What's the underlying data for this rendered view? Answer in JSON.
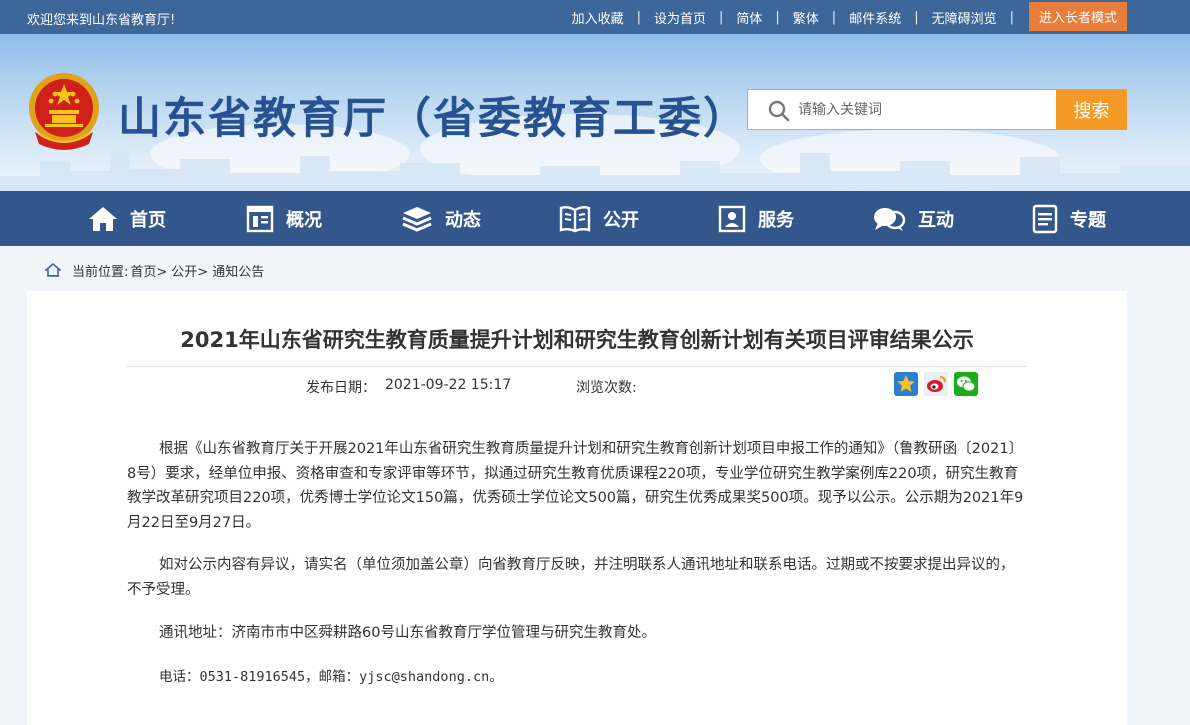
{
  "topbar": {
    "welcome": "欢迎您来到山东省教育厅!",
    "links": [
      "加入收藏",
      "设为首页",
      "简体",
      "繁体",
      "邮件系统",
      "无障碍浏览"
    ],
    "elder_mode": "进入长者模式"
  },
  "header": {
    "site_title": "山东省教育厅（省委教育工委）",
    "search_placeholder": "请输入关键词",
    "search_button": "搜索"
  },
  "nav": [
    {
      "label": "首页",
      "icon": "home-icon"
    },
    {
      "label": "概况",
      "icon": "overview-icon"
    },
    {
      "label": "动态",
      "icon": "stack-icon"
    },
    {
      "label": "公开",
      "icon": "book-icon"
    },
    {
      "label": "服务",
      "icon": "service-icon"
    },
    {
      "label": "互动",
      "icon": "chat-icon"
    },
    {
      "label": "专题",
      "icon": "document-icon"
    }
  ],
  "breadcrumb": {
    "prefix": "当前位置:",
    "items": [
      "首页>",
      "公开>",
      "通知公告"
    ]
  },
  "article": {
    "title": "2021年山东省研究生教育质量提升计划和研究生教育创新计划有关项目评审结果公示",
    "date_label": "发布日期：",
    "date_value": "2021-09-22 15:17",
    "views_label": "浏览次数:",
    "share": [
      "favorite-icon",
      "weibo-icon",
      "wechat-icon"
    ],
    "paragraphs": [
      "根据《山东省教育厅关于开展2021年山东省研究生教育质量提升计划和研究生教育创新计划项目申报工作的通知》（鲁教研函〔2021〕8号）要求，经单位申报、资格审查和专家评审等环节，拟通过研究生教育优质课程220项，专业学位研究生教学案例库220项，研究生教育教学改革研究项目220项，优秀博士学位论文150篇，优秀硕士学位论文500篇，研究生优秀成果奖500项。现予以公示。公示期为2021年9月22日至9月27日。",
      "如对公示内容有异议，请实名（单位须加盖公章）向省教育厅反映，并注明联系人通讯地址和联系电话。过期或不按要求提出异议的，不予受理。",
      "通讯地址：济南市市中区舜耕路60号山东省教育厅学位管理与研究生教育处。",
      "电话：0531-81916545，邮箱：yjsc@shandong.cn。"
    ]
  }
}
